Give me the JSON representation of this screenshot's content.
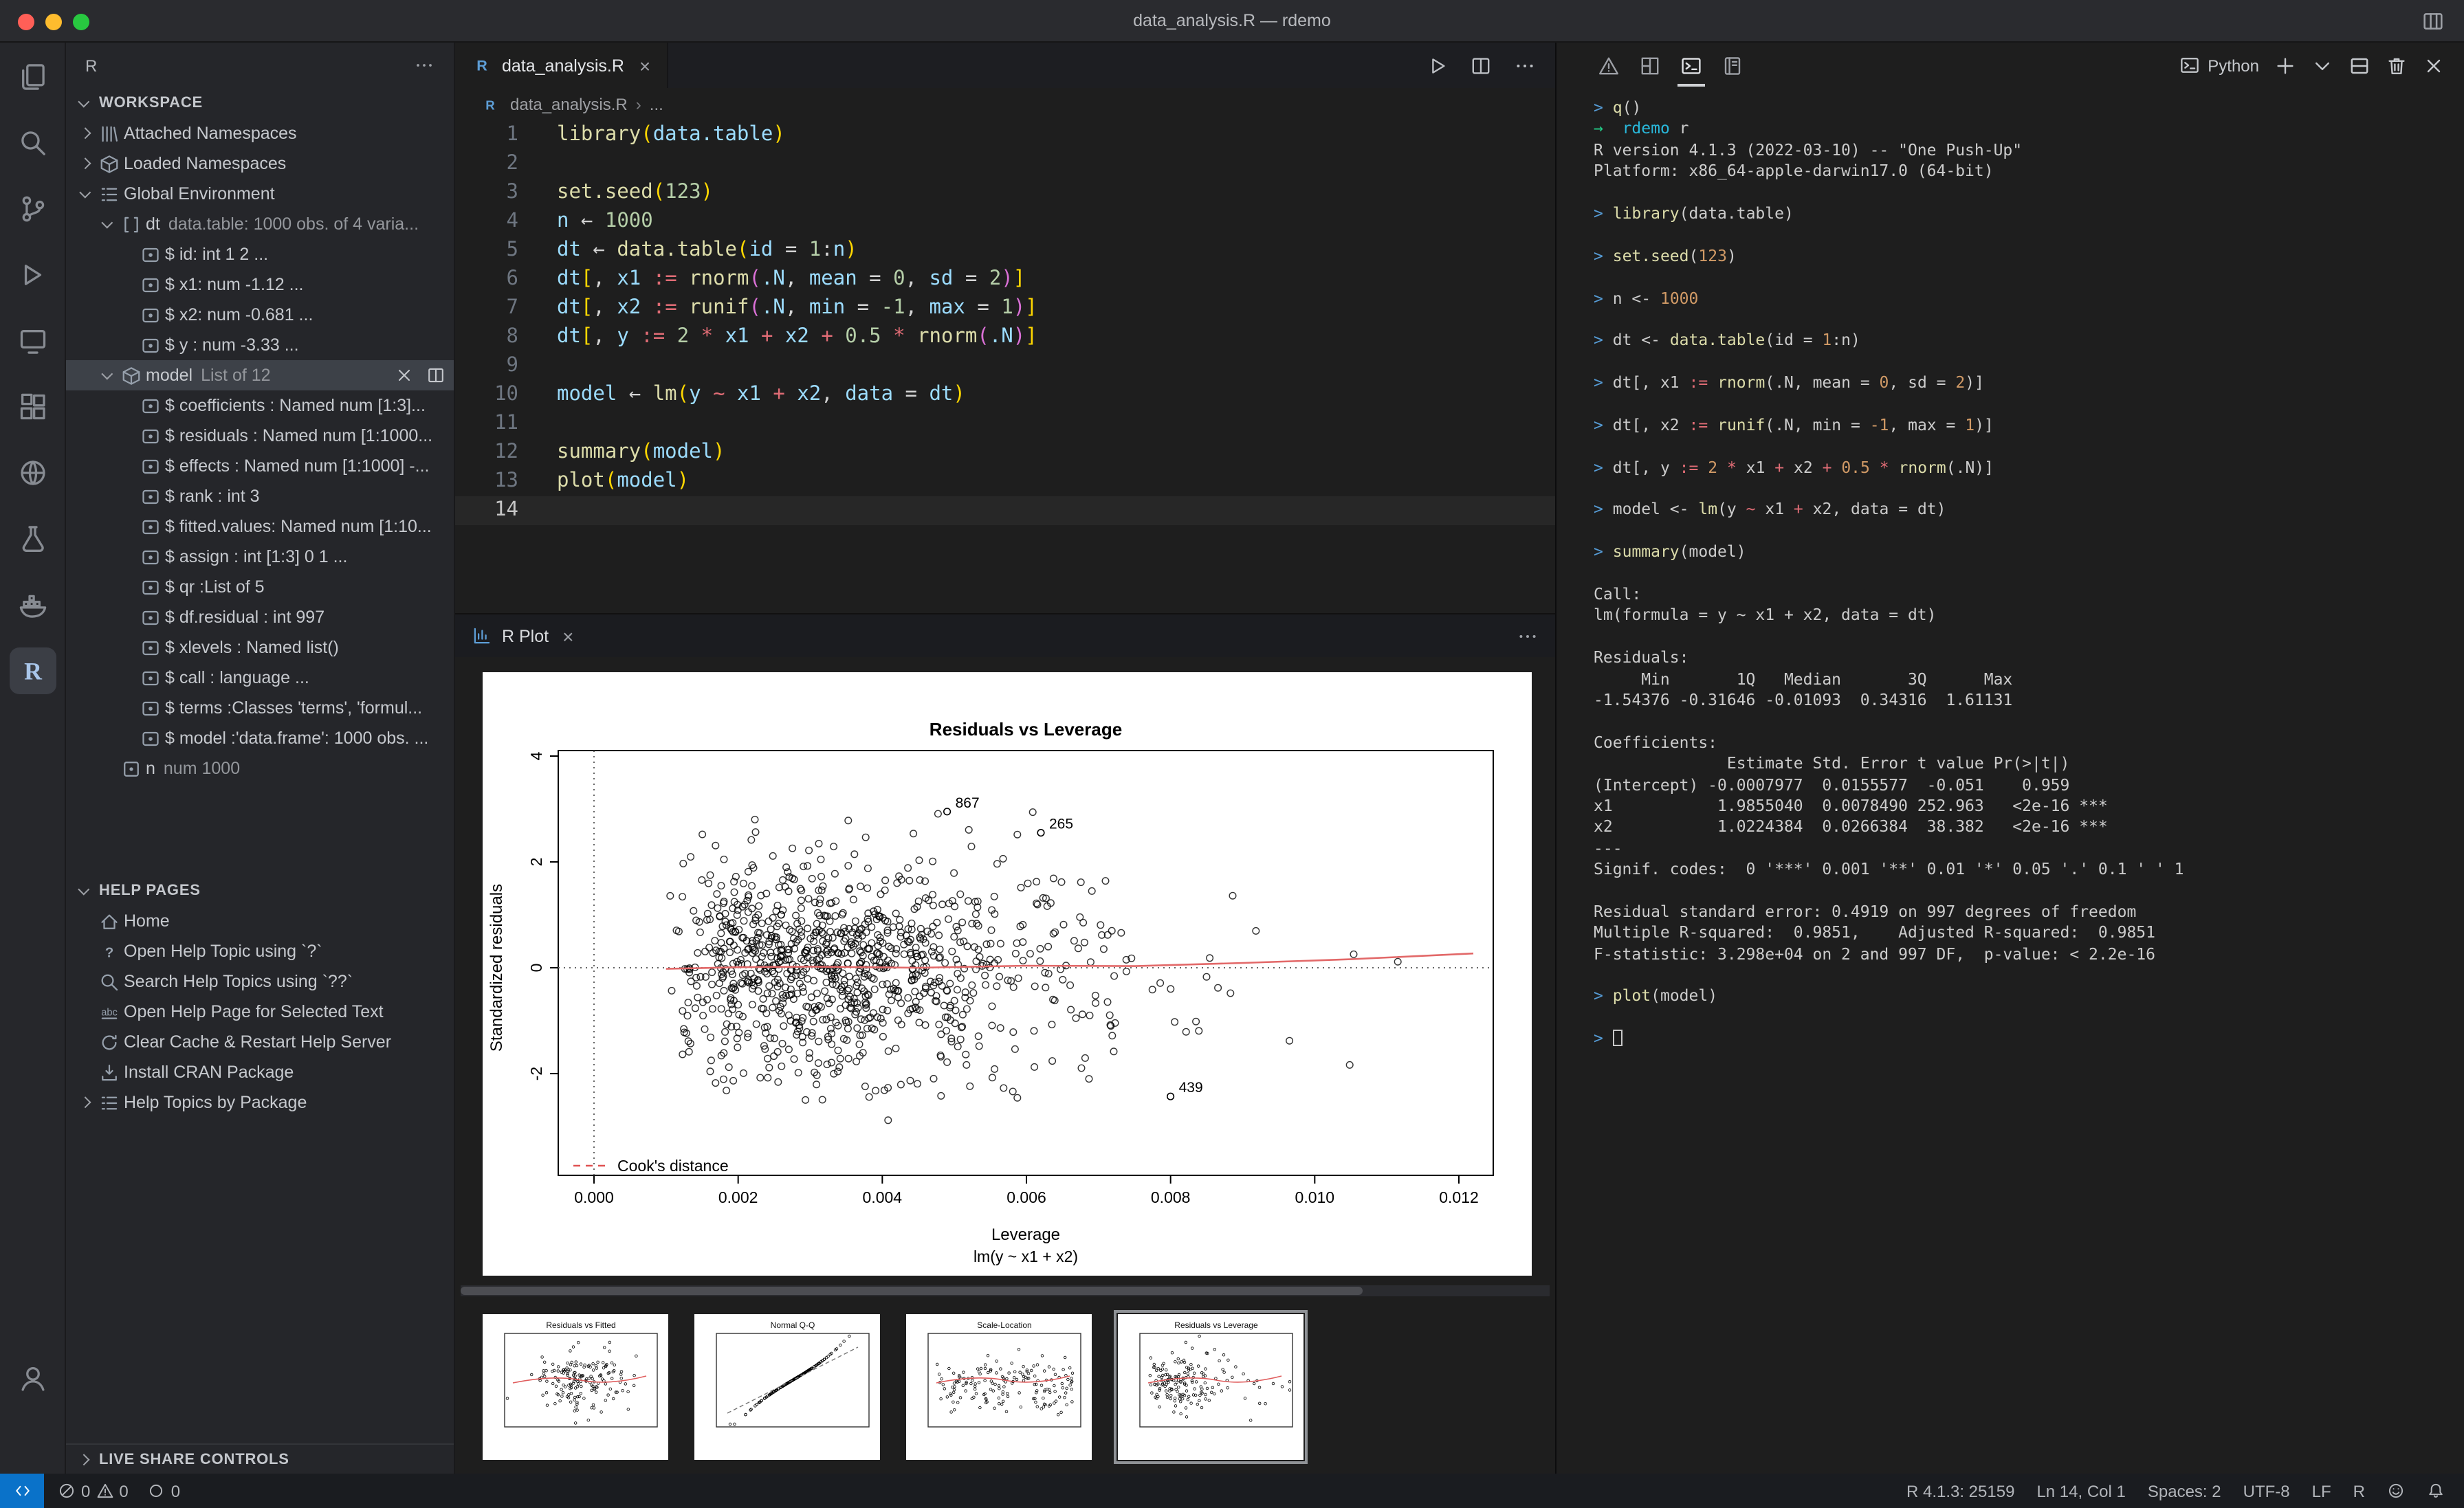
{
  "window": {
    "title": "data_analysis.R — rdemo"
  },
  "activity_bar": {
    "items": [
      {
        "name": "explorer",
        "icon": "files-icon"
      },
      {
        "name": "search",
        "icon": "search-icon"
      },
      {
        "name": "source-control",
        "icon": "source-control-icon"
      },
      {
        "name": "run-and-debug",
        "icon": "run-debug-icon"
      },
      {
        "name": "remote-explorer",
        "icon": "remote-explorer-icon"
      },
      {
        "name": "extensions",
        "icon": "extensions-icon"
      },
      {
        "name": "live-share",
        "icon": "globe-icon"
      },
      {
        "name": "testing",
        "icon": "beaker-icon"
      },
      {
        "name": "docker",
        "icon": "docker-icon"
      },
      {
        "name": "r",
        "icon": "r-icon",
        "active": true
      }
    ],
    "bottom": [
      {
        "name": "accounts",
        "icon": "account-icon"
      }
    ]
  },
  "sidebar": {
    "title": "R",
    "sections": {
      "workspace": "WORKSPACE",
      "help": "HELP PAGES",
      "liveshare": "LIVE SHARE CONTROLS"
    },
    "workspace_items": [
      {
        "d": 0,
        "chev": "right",
        "icon": "library-icon",
        "label": "Attached Namespaces"
      },
      {
        "d": 0,
        "chev": "right",
        "icon": "namespace-icon",
        "label": "Loaded Namespaces"
      },
      {
        "d": 0,
        "chev": "down",
        "icon": "env-icon",
        "label": "Global Environment"
      },
      {
        "d": 1,
        "chev": "down",
        "icon": "df-icon",
        "label": "dt",
        "detail": "data.table: 1000 obs. of 4 varia..."
      },
      {
        "d": 2,
        "icon": "field-icon",
        "label": "$ id: int 1 2 ..."
      },
      {
        "d": 2,
        "icon": "field-icon",
        "label": "$ x1: num -1.12 ..."
      },
      {
        "d": 2,
        "icon": "field-icon",
        "label": "$ x2: num -0.681 ..."
      },
      {
        "d": 2,
        "icon": "field-icon",
        "label": "$ y : num -3.33 ..."
      },
      {
        "d": 1,
        "chev": "down",
        "icon": "list-obj-icon",
        "label": "model",
        "detail": "List of 12",
        "selected": true
      },
      {
        "d": 2,
        "icon": "field-icon",
        "label": "$ coefficients : Named num [1:3]..."
      },
      {
        "d": 2,
        "icon": "field-icon",
        "label": "$ residuals : Named num [1:1000..."
      },
      {
        "d": 2,
        "icon": "field-icon",
        "label": "$ effects : Named num [1:1000] -..."
      },
      {
        "d": 2,
        "icon": "field-icon",
        "label": "$ rank : int 3"
      },
      {
        "d": 2,
        "icon": "field-icon",
        "label": "$ fitted.values: Named num [1:10..."
      },
      {
        "d": 2,
        "icon": "field-icon",
        "label": "$ assign : int [1:3] 0 1 ..."
      },
      {
        "d": 2,
        "icon": "field-icon",
        "label": "$ qr :List of 5"
      },
      {
        "d": 2,
        "icon": "field-icon",
        "label": "$ df.residual : int 997"
      },
      {
        "d": 2,
        "icon": "field-icon",
        "label": "$ xlevels : Named list()"
      },
      {
        "d": 2,
        "icon": "field-icon",
        "label": "$ call : language ..."
      },
      {
        "d": 2,
        "icon": "field-icon",
        "label": "$ terms :Classes 'terms', 'formul..."
      },
      {
        "d": 2,
        "icon": "field-icon",
        "label": "$ model :'data.frame': 1000 obs. ..."
      },
      {
        "d": 1,
        "icon": "value-icon",
        "label": "n",
        "detail": "num 1000"
      }
    ],
    "help_items": [
      {
        "icon": "home-icon",
        "label": "Home"
      },
      {
        "icon": "question-icon",
        "label": "Open Help Topic using `?`"
      },
      {
        "icon": "search-icon",
        "label": "Search Help Topics using `??`"
      },
      {
        "icon": "abc-icon",
        "label": "Open Help Page for Selected Text"
      },
      {
        "icon": "refresh-icon",
        "label": "Clear Cache & Restart Help Server"
      },
      {
        "icon": "cran-icon",
        "label": "Install CRAN Package"
      },
      {
        "chev": "right",
        "icon": "topics-icon",
        "label": "Help Topics by Package"
      }
    ]
  },
  "editor": {
    "tab_label": "data_analysis.R",
    "breadcrumb_file": "data_analysis.R",
    "breadcrumb_more": "...",
    "lines": [
      [
        [
          "f",
          "library"
        ],
        [
          "b1",
          "("
        ],
        [
          "v",
          "data.table"
        ],
        [
          "b1",
          ")"
        ]
      ],
      [],
      [
        [
          "f",
          "set.seed"
        ],
        [
          "b1",
          "("
        ],
        [
          "n",
          "123"
        ],
        [
          "b1",
          ")"
        ]
      ],
      [
        [
          "v",
          "n"
        ],
        [
          "w",
          " ← "
        ],
        [
          "n",
          "1000"
        ]
      ],
      [
        [
          "v",
          "dt"
        ],
        [
          "w",
          " ← "
        ],
        [
          "f",
          "data.table"
        ],
        [
          "b1",
          "("
        ],
        [
          "v",
          "id"
        ],
        [
          "w",
          " = "
        ],
        [
          "n",
          "1"
        ],
        [
          "w",
          ":"
        ],
        [
          "v",
          "n"
        ],
        [
          "b1",
          ")"
        ]
      ],
      [
        [
          "v",
          "dt"
        ],
        [
          "b1",
          "["
        ],
        [
          "w",
          ", "
        ],
        [
          "v",
          "x1"
        ],
        [
          "w",
          " "
        ],
        [
          "r",
          ":="
        ],
        [
          "w",
          " "
        ],
        [
          "f",
          "rnorm"
        ],
        [
          "b2",
          "("
        ],
        [
          "v",
          ".N"
        ],
        [
          "w",
          ", "
        ],
        [
          "v",
          "mean"
        ],
        [
          "w",
          " = "
        ],
        [
          "n",
          "0"
        ],
        [
          "w",
          ", "
        ],
        [
          "v",
          "sd"
        ],
        [
          "w",
          " = "
        ],
        [
          "n",
          "2"
        ],
        [
          "b2",
          ")"
        ],
        [
          "b1",
          "]"
        ]
      ],
      [
        [
          "v",
          "dt"
        ],
        [
          "b1",
          "["
        ],
        [
          "w",
          ", "
        ],
        [
          "v",
          "x2"
        ],
        [
          "w",
          " "
        ],
        [
          "r",
          ":="
        ],
        [
          "w",
          " "
        ],
        [
          "f",
          "runif"
        ],
        [
          "b2",
          "("
        ],
        [
          "v",
          ".N"
        ],
        [
          "w",
          ", "
        ],
        [
          "v",
          "min"
        ],
        [
          "w",
          " = "
        ],
        [
          "n",
          "-1"
        ],
        [
          "w",
          ", "
        ],
        [
          "v",
          "max"
        ],
        [
          "w",
          " = "
        ],
        [
          "n",
          "1"
        ],
        [
          "b2",
          ")"
        ],
        [
          "b1",
          "]"
        ]
      ],
      [
        [
          "v",
          "dt"
        ],
        [
          "b1",
          "["
        ],
        [
          "w",
          ", "
        ],
        [
          "v",
          "y"
        ],
        [
          "w",
          " "
        ],
        [
          "r",
          ":="
        ],
        [
          "w",
          " "
        ],
        [
          "n",
          "2"
        ],
        [
          "w",
          " "
        ],
        [
          "r",
          "*"
        ],
        [
          "w",
          " "
        ],
        [
          "v",
          "x1"
        ],
        [
          "w",
          " "
        ],
        [
          "r",
          "+"
        ],
        [
          "w",
          " "
        ],
        [
          "v",
          "x2"
        ],
        [
          "w",
          " "
        ],
        [
          "r",
          "+"
        ],
        [
          "w",
          " "
        ],
        [
          "n",
          "0.5"
        ],
        [
          "w",
          " "
        ],
        [
          "r",
          "*"
        ],
        [
          "w",
          " "
        ],
        [
          "f",
          "rnorm"
        ],
        [
          "b2",
          "("
        ],
        [
          "v",
          ".N"
        ],
        [
          "b2",
          ")"
        ],
        [
          "b1",
          "]"
        ]
      ],
      [],
      [
        [
          "v",
          "model"
        ],
        [
          "w",
          " ← "
        ],
        [
          "f",
          "lm"
        ],
        [
          "b1",
          "("
        ],
        [
          "v",
          "y"
        ],
        [
          "w",
          " "
        ],
        [
          "r",
          "~"
        ],
        [
          "w",
          " "
        ],
        [
          "v",
          "x1"
        ],
        [
          "w",
          " "
        ],
        [
          "r",
          "+"
        ],
        [
          "w",
          " "
        ],
        [
          "v",
          "x2"
        ],
        [
          "w",
          ", "
        ],
        [
          "v",
          "data"
        ],
        [
          "w",
          " = "
        ],
        [
          "v",
          "dt"
        ],
        [
          "b1",
          ")"
        ]
      ],
      [],
      [
        [
          "f",
          "summary"
        ],
        [
          "b1",
          "("
        ],
        [
          "v",
          "model"
        ],
        [
          "b1",
          ")"
        ]
      ],
      [
        [
          "f",
          "plot"
        ],
        [
          "b1",
          "("
        ],
        [
          "v",
          "model"
        ],
        [
          "b1",
          ")"
        ]
      ],
      []
    ]
  },
  "plot_panel": {
    "tab_label": "R Plot",
    "chart_data": {
      "type": "scatter",
      "title": "Residuals vs Leverage",
      "xlabel": "Leverage",
      "sublabel": "lm(y ~ x1 + x2)",
      "ylabel": "Standardized residuals",
      "xlim": [
        0,
        0.012
      ],
      "ylim": [
        -2.6,
        4.1
      ],
      "xticks": [
        0,
        0.002,
        0.004,
        0.006,
        0.008,
        0.01,
        0.012
      ],
      "yticks": [
        -2,
        0,
        2,
        4
      ],
      "n_points": 997,
      "seed": 20,
      "labeled_points": [
        {
          "label": "867",
          "x": 0.0049,
          "y": 2.95
        },
        {
          "label": "265",
          "x": 0.0062,
          "y": 2.55
        },
        {
          "label": "439",
          "x": 0.008,
          "y": -2.43
        }
      ],
      "legend": "Cook's distance",
      "smooth_line": [
        [
          0.001,
          -0.02
        ],
        [
          0.002,
          0.01
        ],
        [
          0.003,
          0.02
        ],
        [
          0.0045,
          0
        ],
        [
          0.006,
          0.04
        ],
        [
          0.0075,
          0.03
        ],
        [
          0.009,
          0.09
        ],
        [
          0.0105,
          0.16
        ],
        [
          0.0122,
          0.27
        ]
      ]
    },
    "thumbnails": [
      {
        "title": "Residuals vs Fitted"
      },
      {
        "title": "Normal Q-Q"
      },
      {
        "title": "Scale-Location"
      },
      {
        "title": "Residuals vs Leverage",
        "selected": true
      }
    ]
  },
  "terminal": {
    "shell_label": "Python",
    "lines": [
      [
        [
          "p",
          "> "
        ],
        [
          "f",
          "q"
        ],
        [
          "w",
          "()"
        ]
      ],
      [
        [
          "g",
          "→  "
        ],
        [
          "c",
          "rdemo"
        ],
        [
          "w",
          " r"
        ]
      ],
      [
        [
          "w",
          "R version 4.1.3 (2022-03-10) -- \"One Push-Up\""
        ]
      ],
      [
        [
          "w",
          "Platform: x86_64-apple-darwin17.0 (64-bit)"
        ]
      ],
      [],
      [
        [
          "p",
          "> "
        ],
        [
          "f",
          "library"
        ],
        [
          "w",
          "(data.table)"
        ]
      ],
      [],
      [
        [
          "p",
          "> "
        ],
        [
          "f",
          "set.seed"
        ],
        [
          "w",
          "("
        ],
        [
          "o",
          "123"
        ],
        [
          "w",
          ")"
        ]
      ],
      [],
      [
        [
          "p",
          "> "
        ],
        [
          "w",
          "n <- "
        ],
        [
          "o",
          "1000"
        ]
      ],
      [],
      [
        [
          "p",
          "> "
        ],
        [
          "w",
          "dt <- "
        ],
        [
          "f",
          "data.table"
        ],
        [
          "w",
          "(id = "
        ],
        [
          "o",
          "1"
        ],
        [
          "w",
          ":n)"
        ]
      ],
      [],
      [
        [
          "p",
          "> "
        ],
        [
          "w",
          "dt[, x1 "
        ],
        [
          "r",
          ":="
        ],
        [
          "w",
          " "
        ],
        [
          "f",
          "rnorm"
        ],
        [
          "w",
          "(.N, mean = "
        ],
        [
          "o",
          "0"
        ],
        [
          "w",
          ", sd = "
        ],
        [
          "o",
          "2"
        ],
        [
          "w",
          ")]"
        ]
      ],
      [],
      [
        [
          "p",
          "> "
        ],
        [
          "w",
          "dt[, x2 "
        ],
        [
          "r",
          ":="
        ],
        [
          "w",
          " "
        ],
        [
          "f",
          "runif"
        ],
        [
          "w",
          "(.N, min = "
        ],
        [
          "o",
          "-1"
        ],
        [
          "w",
          ", max = "
        ],
        [
          "o",
          "1"
        ],
        [
          "w",
          ")]"
        ]
      ],
      [],
      [
        [
          "p",
          "> "
        ],
        [
          "w",
          "dt[, y "
        ],
        [
          "r",
          ":="
        ],
        [
          "w",
          " "
        ],
        [
          "o",
          "2"
        ],
        [
          "w",
          " "
        ],
        [
          "r",
          "*"
        ],
        [
          "w",
          " x1 "
        ],
        [
          "r",
          "+"
        ],
        [
          "w",
          " x2 "
        ],
        [
          "r",
          "+"
        ],
        [
          "w",
          " "
        ],
        [
          "o",
          "0.5"
        ],
        [
          "w",
          " "
        ],
        [
          "r",
          "*"
        ],
        [
          "w",
          " "
        ],
        [
          "f",
          "rnorm"
        ],
        [
          "w",
          "(.N)]"
        ]
      ],
      [],
      [
        [
          "p",
          "> "
        ],
        [
          "w",
          "model <- "
        ],
        [
          "f",
          "lm"
        ],
        [
          "w",
          "(y "
        ],
        [
          "r",
          "~"
        ],
        [
          "w",
          " x1 "
        ],
        [
          "r",
          "+"
        ],
        [
          "w",
          " x2, data = dt)"
        ]
      ],
      [],
      [
        [
          "p",
          "> "
        ],
        [
          "f",
          "summary"
        ],
        [
          "w",
          "(model)"
        ]
      ],
      [],
      [
        [
          "w",
          "Call:"
        ]
      ],
      [
        [
          "w",
          "lm(formula = y ~ x1 + x2, data = dt)"
        ]
      ],
      [],
      [
        [
          "w",
          "Residuals:"
        ]
      ],
      [
        [
          "w",
          "     Min       1Q   Median       3Q      Max "
        ]
      ],
      [
        [
          "w",
          "-1.54376 -0.31646 -0.01093  0.34316  1.61131 "
        ]
      ],
      [],
      [
        [
          "w",
          "Coefficients:"
        ]
      ],
      [
        [
          "w",
          "              Estimate Std. Error t value Pr(>|t|)    "
        ]
      ],
      [
        [
          "w",
          "(Intercept) -0.0007977  0.0155577  -0.051    0.959    "
        ]
      ],
      [
        [
          "w",
          "x1           1.9855040  0.0078490 252.963   <2e-16 ***"
        ]
      ],
      [
        [
          "w",
          "x2           1.0224384  0.0266384  38.382   <2e-16 ***"
        ]
      ],
      [
        [
          "w",
          "---"
        ]
      ],
      [
        [
          "w",
          "Signif. codes:  0 '***' 0.001 '**' 0.01 '*' 0.05 '.' 0.1 ' ' 1"
        ]
      ],
      [],
      [
        [
          "w",
          "Residual standard error: 0.4919 on 997 degrees of freedom"
        ]
      ],
      [
        [
          "w",
          "Multiple R-squared:  0.9851,    Adjusted R-squared:  0.9851"
        ]
      ],
      [
        [
          "w",
          "F-statistic: 3.298e+04 on 2 and 997 DF,  p-value: < 2.2e-16"
        ]
      ],
      [],
      [
        [
          "p",
          "> "
        ],
        [
          "f",
          "plot"
        ],
        [
          "w",
          "(model)"
        ]
      ],
      [],
      [
        [
          "p",
          "> "
        ],
        [
          "cur",
          ""
        ]
      ]
    ]
  },
  "status_bar": {
    "errors": "0",
    "warnings": "0",
    "extra": "0",
    "r_version": "R 4.1.3: 25159",
    "cursor": "Ln 14, Col 1",
    "spaces": "Spaces: 2",
    "encoding": "UTF-8",
    "eol": "LF",
    "language": "R"
  }
}
